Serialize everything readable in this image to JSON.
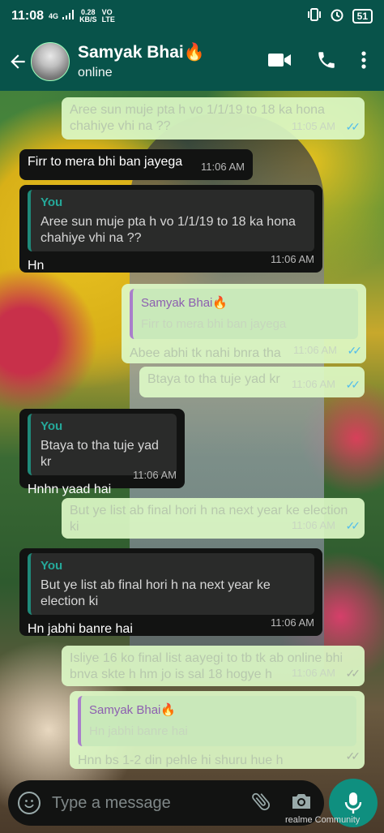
{
  "status_bar": {
    "time": "11:08",
    "network": "4G",
    "speed_value": "0.28",
    "speed_unit": "KB/S",
    "volte": "VO\nLTE",
    "battery": "51"
  },
  "header": {
    "contact_name": "Samyak Bhai🔥",
    "contact_status": "online"
  },
  "messages": [
    {
      "type": "out",
      "text": "Aree sun muje pta h vo 1/1/19 to 18 ka hona chahiye vhi na ??",
      "time": "11:05 AM"
    },
    {
      "type": "in",
      "text": "Firr to mera bhi ban jayega",
      "time": "11:06 AM"
    },
    {
      "type": "in",
      "quote_author": "You",
      "quote_text": "Aree sun muje pta h vo 1/1/19 to 18 ka hona chahiye vhi na ??",
      "text": "Hn",
      "time": "11:06 AM"
    },
    {
      "type": "out",
      "quote_author": "Samyak Bhai🔥",
      "quote_text": "Firr to mera bhi ban jayega",
      "text": "Abee abhi tk nahi bnra tha",
      "time": "11:06 AM"
    },
    {
      "type": "out",
      "text": "Btaya to tha tuje yad kr",
      "time": "11:06 AM"
    },
    {
      "type": "in",
      "quote_author": "You",
      "quote_text": "Btaya to tha tuje yad kr",
      "text": "Hnhn yaad hai",
      "time": "11:06 AM"
    },
    {
      "type": "out",
      "text": "But ye list ab final hori h na next year ke election ki",
      "time": "11:06 AM"
    },
    {
      "type": "in",
      "quote_author": "You",
      "quote_text": "But ye list ab final hori h na next year ke election ki",
      "text": "Hn jabhi banre hai",
      "time": "11:06 AM"
    },
    {
      "type": "out",
      "text": "Isliye 16 ko final list aayegi to tb tk ab online bhi bnva skte h hm jo is sal 18 hogye h",
      "time": "11:06 AM"
    },
    {
      "type": "out",
      "quote_author": "Samyak Bhai🔥",
      "quote_text": "Hn jabhi banre hai",
      "text": "Hnn bs 1-2 din pehle hi shuru hue h",
      "time": ""
    }
  ],
  "input": {
    "placeholder": "Type a message"
  },
  "brand_watermark": "realme Community",
  "colors": {
    "header": "#08534a",
    "incoming_bubble": "#121312",
    "outgoing_bubble": "#dcf8c6",
    "read_ticks": "#53bdeb",
    "mic_button": "#0f8f7f"
  }
}
